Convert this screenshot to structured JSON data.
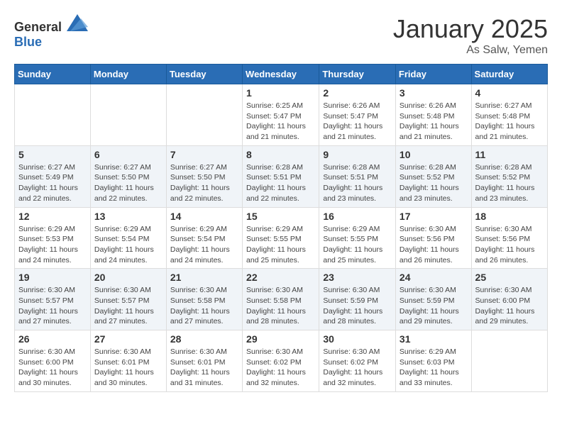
{
  "header": {
    "logo_general": "General",
    "logo_blue": "Blue",
    "month": "January 2025",
    "location": "As Salw, Yemen"
  },
  "weekdays": [
    "Sunday",
    "Monday",
    "Tuesday",
    "Wednesday",
    "Thursday",
    "Friday",
    "Saturday"
  ],
  "weeks": [
    [
      {
        "day": "",
        "sunrise": "",
        "sunset": "",
        "daylight": ""
      },
      {
        "day": "",
        "sunrise": "",
        "sunset": "",
        "daylight": ""
      },
      {
        "day": "",
        "sunrise": "",
        "sunset": "",
        "daylight": ""
      },
      {
        "day": "1",
        "sunrise": "Sunrise: 6:25 AM",
        "sunset": "Sunset: 5:47 PM",
        "daylight": "Daylight: 11 hours and 21 minutes."
      },
      {
        "day": "2",
        "sunrise": "Sunrise: 6:26 AM",
        "sunset": "Sunset: 5:47 PM",
        "daylight": "Daylight: 11 hours and 21 minutes."
      },
      {
        "day": "3",
        "sunrise": "Sunrise: 6:26 AM",
        "sunset": "Sunset: 5:48 PM",
        "daylight": "Daylight: 11 hours and 21 minutes."
      },
      {
        "day": "4",
        "sunrise": "Sunrise: 6:27 AM",
        "sunset": "Sunset: 5:48 PM",
        "daylight": "Daylight: 11 hours and 21 minutes."
      }
    ],
    [
      {
        "day": "5",
        "sunrise": "Sunrise: 6:27 AM",
        "sunset": "Sunset: 5:49 PM",
        "daylight": "Daylight: 11 hours and 22 minutes."
      },
      {
        "day": "6",
        "sunrise": "Sunrise: 6:27 AM",
        "sunset": "Sunset: 5:50 PM",
        "daylight": "Daylight: 11 hours and 22 minutes."
      },
      {
        "day": "7",
        "sunrise": "Sunrise: 6:27 AM",
        "sunset": "Sunset: 5:50 PM",
        "daylight": "Daylight: 11 hours and 22 minutes."
      },
      {
        "day": "8",
        "sunrise": "Sunrise: 6:28 AM",
        "sunset": "Sunset: 5:51 PM",
        "daylight": "Daylight: 11 hours and 22 minutes."
      },
      {
        "day": "9",
        "sunrise": "Sunrise: 6:28 AM",
        "sunset": "Sunset: 5:51 PM",
        "daylight": "Daylight: 11 hours and 23 minutes."
      },
      {
        "day": "10",
        "sunrise": "Sunrise: 6:28 AM",
        "sunset": "Sunset: 5:52 PM",
        "daylight": "Daylight: 11 hours and 23 minutes."
      },
      {
        "day": "11",
        "sunrise": "Sunrise: 6:28 AM",
        "sunset": "Sunset: 5:52 PM",
        "daylight": "Daylight: 11 hours and 23 minutes."
      }
    ],
    [
      {
        "day": "12",
        "sunrise": "Sunrise: 6:29 AM",
        "sunset": "Sunset: 5:53 PM",
        "daylight": "Daylight: 11 hours and 24 minutes."
      },
      {
        "day": "13",
        "sunrise": "Sunrise: 6:29 AM",
        "sunset": "Sunset: 5:54 PM",
        "daylight": "Daylight: 11 hours and 24 minutes."
      },
      {
        "day": "14",
        "sunrise": "Sunrise: 6:29 AM",
        "sunset": "Sunset: 5:54 PM",
        "daylight": "Daylight: 11 hours and 24 minutes."
      },
      {
        "day": "15",
        "sunrise": "Sunrise: 6:29 AM",
        "sunset": "Sunset: 5:55 PM",
        "daylight": "Daylight: 11 hours and 25 minutes."
      },
      {
        "day": "16",
        "sunrise": "Sunrise: 6:29 AM",
        "sunset": "Sunset: 5:55 PM",
        "daylight": "Daylight: 11 hours and 25 minutes."
      },
      {
        "day": "17",
        "sunrise": "Sunrise: 6:30 AM",
        "sunset": "Sunset: 5:56 PM",
        "daylight": "Daylight: 11 hours and 26 minutes."
      },
      {
        "day": "18",
        "sunrise": "Sunrise: 6:30 AM",
        "sunset": "Sunset: 5:56 PM",
        "daylight": "Daylight: 11 hours and 26 minutes."
      }
    ],
    [
      {
        "day": "19",
        "sunrise": "Sunrise: 6:30 AM",
        "sunset": "Sunset: 5:57 PM",
        "daylight": "Daylight: 11 hours and 27 minutes."
      },
      {
        "day": "20",
        "sunrise": "Sunrise: 6:30 AM",
        "sunset": "Sunset: 5:57 PM",
        "daylight": "Daylight: 11 hours and 27 minutes."
      },
      {
        "day": "21",
        "sunrise": "Sunrise: 6:30 AM",
        "sunset": "Sunset: 5:58 PM",
        "daylight": "Daylight: 11 hours and 27 minutes."
      },
      {
        "day": "22",
        "sunrise": "Sunrise: 6:30 AM",
        "sunset": "Sunset: 5:58 PM",
        "daylight": "Daylight: 11 hours and 28 minutes."
      },
      {
        "day": "23",
        "sunrise": "Sunrise: 6:30 AM",
        "sunset": "Sunset: 5:59 PM",
        "daylight": "Daylight: 11 hours and 28 minutes."
      },
      {
        "day": "24",
        "sunrise": "Sunrise: 6:30 AM",
        "sunset": "Sunset: 5:59 PM",
        "daylight": "Daylight: 11 hours and 29 minutes."
      },
      {
        "day": "25",
        "sunrise": "Sunrise: 6:30 AM",
        "sunset": "Sunset: 6:00 PM",
        "daylight": "Daylight: 11 hours and 29 minutes."
      }
    ],
    [
      {
        "day": "26",
        "sunrise": "Sunrise: 6:30 AM",
        "sunset": "Sunset: 6:00 PM",
        "daylight": "Daylight: 11 hours and 30 minutes."
      },
      {
        "day": "27",
        "sunrise": "Sunrise: 6:30 AM",
        "sunset": "Sunset: 6:01 PM",
        "daylight": "Daylight: 11 hours and 30 minutes."
      },
      {
        "day": "28",
        "sunrise": "Sunrise: 6:30 AM",
        "sunset": "Sunset: 6:01 PM",
        "daylight": "Daylight: 11 hours and 31 minutes."
      },
      {
        "day": "29",
        "sunrise": "Sunrise: 6:30 AM",
        "sunset": "Sunset: 6:02 PM",
        "daylight": "Daylight: 11 hours and 32 minutes."
      },
      {
        "day": "30",
        "sunrise": "Sunrise: 6:30 AM",
        "sunset": "Sunset: 6:02 PM",
        "daylight": "Daylight: 11 hours and 32 minutes."
      },
      {
        "day": "31",
        "sunrise": "Sunrise: 6:29 AM",
        "sunset": "Sunset: 6:03 PM",
        "daylight": "Daylight: 11 hours and 33 minutes."
      },
      {
        "day": "",
        "sunrise": "",
        "sunset": "",
        "daylight": ""
      }
    ]
  ]
}
